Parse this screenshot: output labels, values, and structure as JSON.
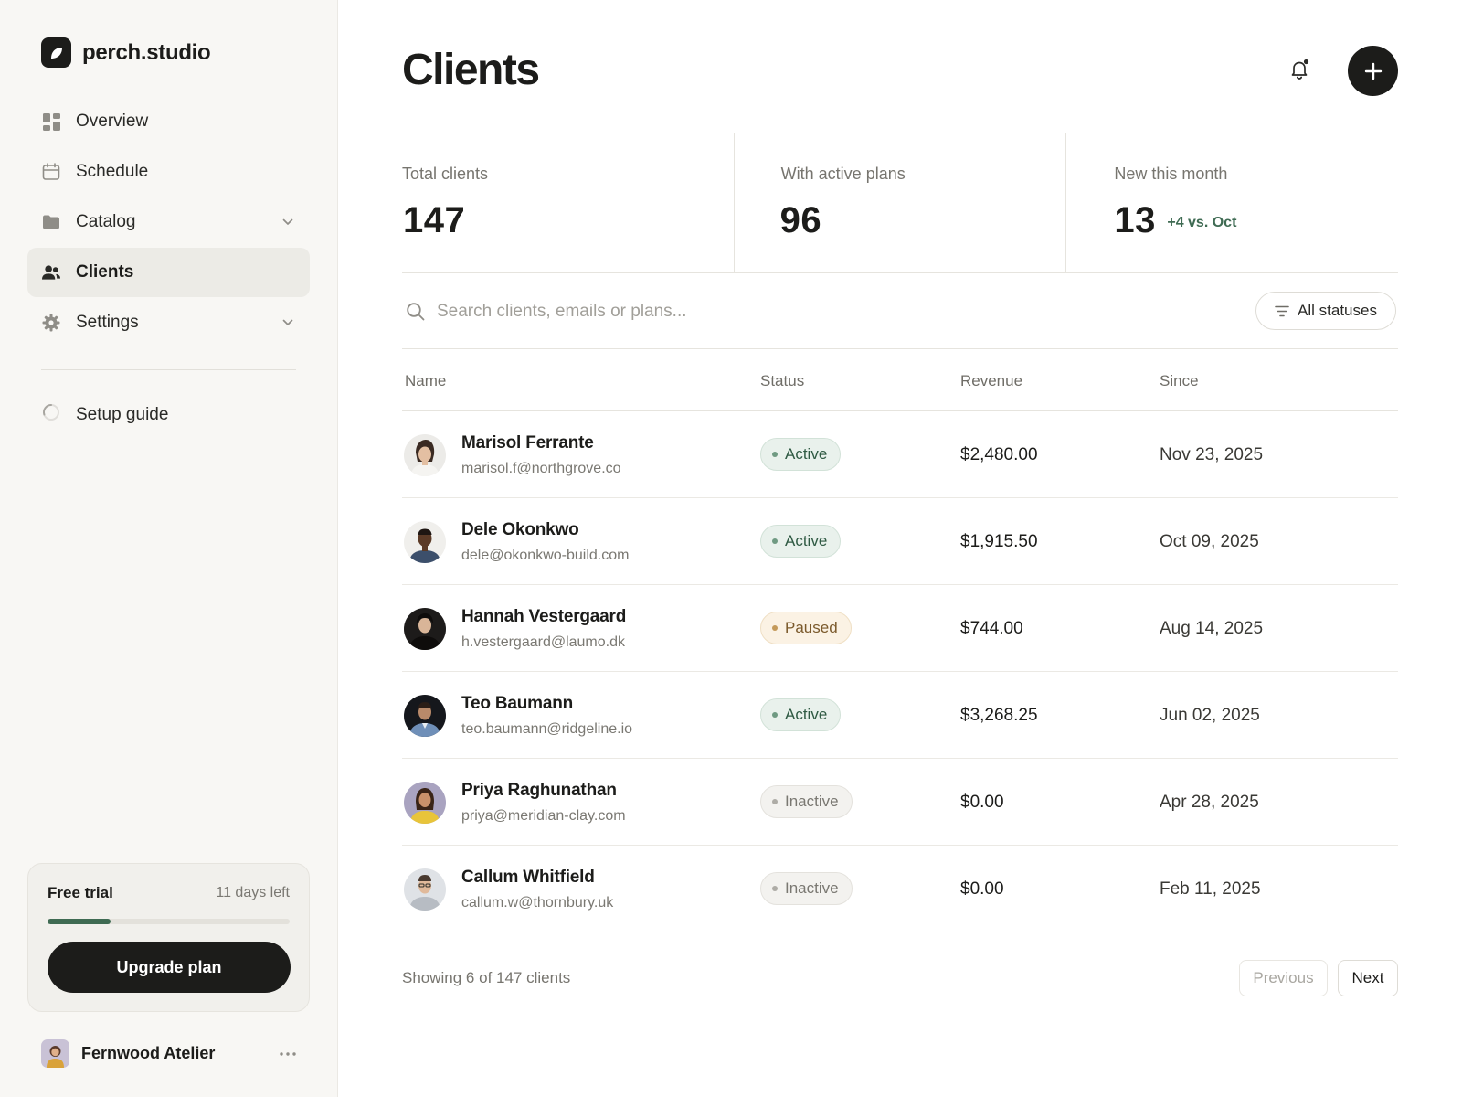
{
  "app": {
    "brand": "perch.studio"
  },
  "sidebar": {
    "items": [
      {
        "label": "Overview",
        "icon": "dashboard-icon",
        "active": false,
        "chevron": false
      },
      {
        "label": "Schedule",
        "icon": "calendar-icon",
        "active": false,
        "chevron": false
      },
      {
        "label": "Catalog",
        "icon": "folder-icon",
        "active": false,
        "chevron": true
      },
      {
        "label": "Clients",
        "icon": "users-icon",
        "active": true,
        "chevron": false
      },
      {
        "label": "Settings",
        "icon": "gear-icon",
        "active": false,
        "chevron": true
      }
    ],
    "setup_label": "Setup guide",
    "trial": {
      "title": "Free trial",
      "days_left": "11 days left",
      "progress_fraction": 0.26,
      "upgrade_label": "Upgrade plan"
    },
    "account": {
      "name": "Fernwood Atelier"
    }
  },
  "page": {
    "title": "Clients"
  },
  "stats": [
    {
      "label": "Total clients",
      "value": "147",
      "delta": ""
    },
    {
      "label": "With active plans",
      "value": "96",
      "delta": ""
    },
    {
      "label": "New this month",
      "value": "13",
      "delta": "+4 vs. Oct"
    }
  ],
  "search": {
    "placeholder": "Search clients, emails or plans...",
    "value": ""
  },
  "filter": {
    "label": "All statuses"
  },
  "table": {
    "columns": [
      "Name",
      "Status",
      "Revenue",
      "Since"
    ],
    "rows": [
      {
        "name": "Marisol Ferrante",
        "email": "marisol.f@northgrove.co",
        "status": "Active",
        "status_kind": "active",
        "revenue": "$2,480.00",
        "since": "Nov 23, 2025"
      },
      {
        "name": "Dele Okonkwo",
        "email": "dele@okonkwo-build.com",
        "status": "Active",
        "status_kind": "active",
        "revenue": "$1,915.50",
        "since": "Oct 09, 2025"
      },
      {
        "name": "Hannah Vestergaard",
        "email": "h.vestergaard@laumo.dk",
        "status": "Paused",
        "status_kind": "paused",
        "revenue": "$744.00",
        "since": "Aug 14, 2025"
      },
      {
        "name": "Teo Baumann",
        "email": "teo.baumann@ridgeline.io",
        "status": "Active",
        "status_kind": "active",
        "revenue": "$3,268.25",
        "since": "Jun 02, 2025"
      },
      {
        "name": "Priya Raghunathan",
        "email": "priya@meridian-clay.com",
        "status": "Inactive",
        "status_kind": "inactive",
        "revenue": "$0.00",
        "since": "Apr 28, 2025"
      },
      {
        "name": "Callum Whitfield",
        "email": "callum.w@thornbury.uk",
        "status": "Inactive",
        "status_kind": "inactive",
        "revenue": "$0.00",
        "since": "Feb 11, 2025"
      }
    ]
  },
  "footer": {
    "showing": "Showing 6 of 147 clients",
    "prev_label": "Previous",
    "next_label": "Next"
  },
  "colors": {
    "accent_green": "#3f6b53",
    "primary_dark": "#1c1c1a",
    "sidebar_bg": "#f8f7f4"
  }
}
